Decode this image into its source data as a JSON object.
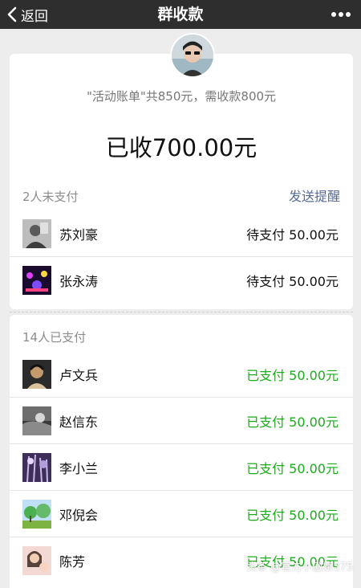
{
  "topbar": {
    "back_label": "返回",
    "title": "群收款"
  },
  "summary": {
    "text": "\"活动账单\"共850元，需收款800元",
    "collected": "已收700.00元"
  },
  "unpaid": {
    "header": "2人未支付",
    "remind_label": "发送提醒",
    "items": [
      {
        "name": "苏刘豪",
        "status": "待支付 50.00元"
      },
      {
        "name": "张永涛",
        "status": "待支付 50.00元"
      }
    ]
  },
  "paid": {
    "header": "14人已支付",
    "items": [
      {
        "name": "卢文兵",
        "status": "已支付 50.00元"
      },
      {
        "name": "赵信东",
        "status": "已支付 50.00元"
      },
      {
        "name": "李小兰",
        "status": "已支付 50.00元"
      },
      {
        "name": "邓倪会",
        "status": "已支付 50.00元"
      },
      {
        "name": "陈芳",
        "status": "已支付 50.00元"
      }
    ]
  },
  "watermark": "头条 @官方小傲娇375",
  "colors": {
    "topbar": "#2e2e2e",
    "paid_green": "#1aad19",
    "link_blue": "#576b95",
    "background": "#ededed"
  }
}
